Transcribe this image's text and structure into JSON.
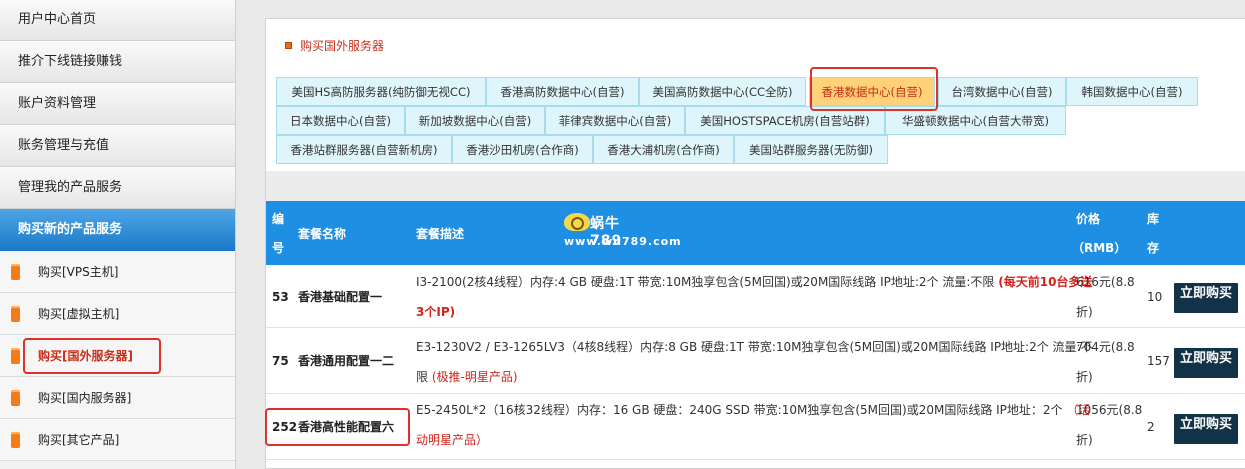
{
  "sidebar": {
    "top_items": [
      "用户中心首页",
      "推介下线链接赚钱",
      "账户资料管理",
      "账务管理与充值",
      "管理我的产品服务"
    ],
    "active_section": "购买新的产品服务",
    "sub_items": [
      "购买[VPS主机]",
      "购买[虚拟主机]",
      "购买[国外服务器]",
      "购买[国内服务器]",
      "购买[其它产品]"
    ]
  },
  "panel": {
    "title": "购买国外服务器",
    "tabs": [
      "美国HS高防服务器(纯防御无视CC)",
      "香港高防数据中心(自营)",
      "美国高防数据中心(CC全防)",
      "香港数据中心(自营)",
      "台湾数据中心(自营)",
      "韩国数据中心(自营)",
      "日本数据中心(自营)",
      "新加坡数据中心(自营)",
      "菲律宾数据中心(自营)",
      "美国HOSTSPACE机房(自营站群)",
      "华盛顿数据中心(自营大带宽)",
      "香港站群服务器(自营新机房)",
      "香港沙田机房(合作商)",
      "香港大浦机房(合作商)",
      "美国站群服务器(无防御)"
    ]
  },
  "table": {
    "headers": {
      "id_1": "编",
      "id_2": "号",
      "name": "套餐名称",
      "desc": "套餐描述",
      "price_1": "价格",
      "price_2": "（RMB）",
      "stock_1": "库",
      "stock_2": "存"
    },
    "watermark": {
      "brand": "蜗牛789",
      "url": "www.wn789.com"
    },
    "buy_label": "立即购买",
    "rows": [
      {
        "id": "53",
        "name": "香港基础配置一",
        "desc_line1": "I3-2100(2核4线程）内存:4 GB 硬盘:1T 带宽:10M独享包含(5M回国)或20M国际线路 IP地址:2个 流量:不限 ",
        "promo_a": "(每天前10台多送",
        "promo_b": "3个IP)",
        "price_1": "616元(8.8",
        "price_2": "折)",
        "stock": "10"
      },
      {
        "id": "75",
        "name": "香港通用配置一二",
        "desc_line1": "E3-1230V2 / E3-1265LV3（4核8线程）内存:8 GB 硬盘:1T 带宽:10M独享包含(5M回国)或20M国际线路 IP地址:2个 流量:不",
        "desc_line2": "限 ",
        "promo": "(极推-明星产品)",
        "price_1": "704元(8.8",
        "price_2": "折)",
        "stock": "157"
      },
      {
        "id": "252",
        "name": "香港高性能配置六",
        "desc_line1": "E5-2450L*2（16核32线程）内存：16 GB 硬盘：240G SSD 带宽:10M独享包含(5M回国)或20M国际线路  IP地址：2个 ",
        "promo_a": "（活",
        "promo_b": "动明星产品）",
        "price_1": "1056元(8.8",
        "price_2": "折)",
        "stock": "2"
      }
    ]
  },
  "colors": {
    "accent_blue": "#1f8fe4",
    "highlight_red": "#e0312b",
    "tab_bg": "#def5fb",
    "tab_active_bg": "#ffd27a"
  }
}
